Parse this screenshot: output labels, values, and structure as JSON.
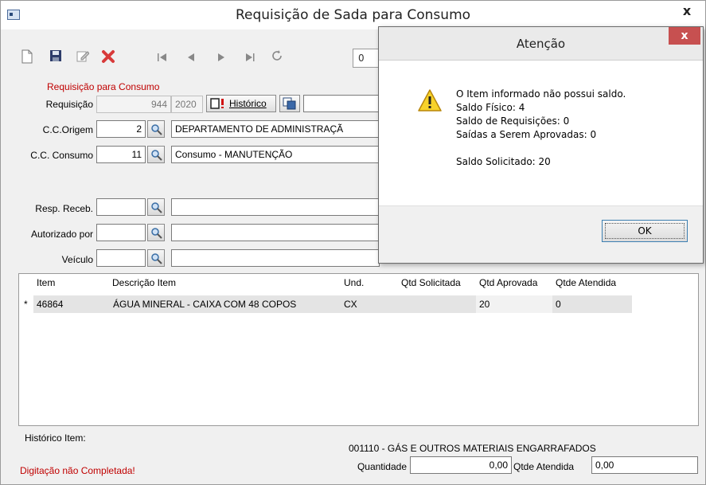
{
  "window": {
    "title": "Requisição de Sada para Consumo",
    "close_label": "x"
  },
  "toolbar": {
    "page_value": "0"
  },
  "form": {
    "section_title": "Requisição para Consumo",
    "requisicao_label": "Requisição",
    "requisicao_number": "944",
    "requisicao_year": "2020",
    "historico_label": "Histórico",
    "cc_origem_label": "C.C.Origem",
    "cc_origem_code": "2",
    "cc_origem_name": "DEPARTAMENTO DE ADMINISTRAÇÃ",
    "cc_consumo_label": "C.C. Consumo",
    "cc_consumo_code": "11",
    "cc_consumo_name": "Consumo - MANUTENÇÃO",
    "resp_receb_label": "Resp. Receb.",
    "autorizado_label": "Autorizado por",
    "veiculo_label": "Veículo"
  },
  "grid": {
    "columns": [
      "Item",
      "Descrição Item",
      "Und.",
      "Qtd Solicitada",
      "Qtd Aprovada",
      "Qtde Atendida"
    ],
    "rows": [
      {
        "marker": "*",
        "item": "46864",
        "descricao": "ÁGUA MINERAL - CAIXA COM 48 COPOS",
        "und": "CX",
        "qtd_solicitada": "",
        "qtd_aprovada": "20",
        "qtde_atendida": "0"
      }
    ]
  },
  "bottom": {
    "historico_item_label": "Histórico Item:",
    "group_text": "001110 - GÁS E OUTROS MATERIAIS ENGARRAFADOS",
    "quantidade_label": "Quantidade",
    "quantidade_value": "0,00",
    "qtde_atendida_label": "Qtde Atendida",
    "qtde_atendida_value": "0,00",
    "status": "Digitação não Completada!"
  },
  "dialog": {
    "title": "Atenção",
    "close_label": "x",
    "lines": [
      "O Item informado não possui saldo.",
      "Saldo Físico: 4",
      "Saldo de Requisições: 0",
      "Saídas a Serem Aprovadas: 0",
      "",
      "Saldo Solicitado: 20"
    ],
    "ok_label": "OK"
  },
  "icons": [
    "new-file-icon",
    "save-icon",
    "edit-icon",
    "delete-icon",
    "first-record-icon",
    "previous-record-icon",
    "next-record-icon",
    "last-record-icon",
    "refresh-icon",
    "search-icon",
    "warning-icon",
    "copy-icon"
  ]
}
